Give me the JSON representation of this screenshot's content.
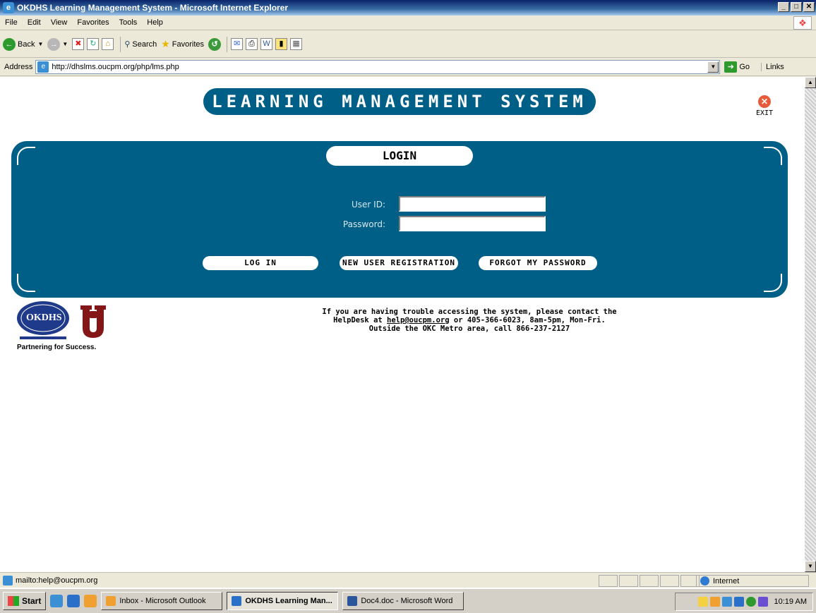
{
  "window": {
    "title": "OKDHS Learning Management System - Microsoft Internet Explorer",
    "min": "_",
    "max": "□",
    "close": "✕"
  },
  "menu": [
    "File",
    "Edit",
    "View",
    "Favorites",
    "Tools",
    "Help"
  ],
  "toolbar": {
    "back": "Back",
    "search": "Search",
    "favorites": "Favorites"
  },
  "address": {
    "label": "Address",
    "url": "http://dhslms.oucpm.org/php/lms.php",
    "go": "Go",
    "links": "Links"
  },
  "page": {
    "banner": "LEARNING MANAGEMENT SYSTEM",
    "exit": "EXIT",
    "login_title": "LOGIN",
    "userid_label": "User ID:",
    "password_label": "Password:",
    "userid_value": "",
    "password_value": "",
    "login_button": "LOG IN",
    "register_button": "NEW USER REGISTRATION",
    "forgot_button": "FORGOT MY PASSWORD",
    "help_line1": "If you are having trouble accessing the system, please contact the",
    "help_prefix": "HelpDesk at ",
    "help_email": "help@oucpm.org",
    "help_suffix": " or 405-366-6023, 8am-5pm, Mon-Fri.",
    "help_line3": "Outside the OKC Metro area, call 866-237-2127",
    "okdhs_text": "OKDHS",
    "partnering": "Partnering for Success."
  },
  "status": {
    "text": "mailto:help@oucpm.org",
    "zone": "Internet"
  },
  "taskbar": {
    "start": "Start",
    "tasks": [
      "Inbox - Microsoft Outlook",
      "OKDHS Learning Man...",
      "Doc4.doc - Microsoft Word"
    ],
    "clock": "10:19 AM"
  },
  "colors": {
    "panel": "#005f86",
    "accent_exit": "#e65b3a",
    "ou_crimson": "#841617"
  }
}
